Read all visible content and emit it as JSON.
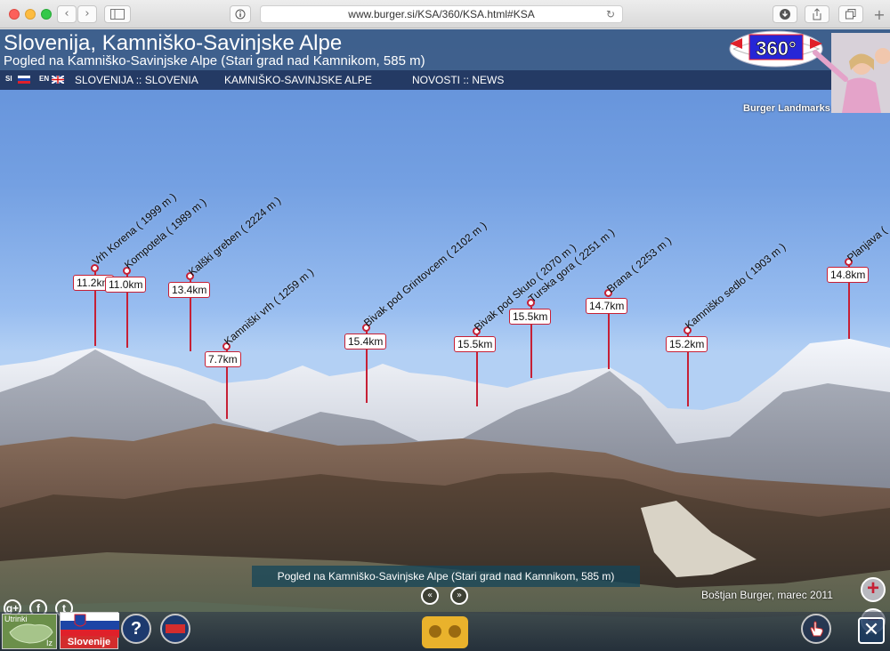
{
  "browser": {
    "url": "www.burger.si/KSA/360/KSA.html#KSA",
    "back": "‹",
    "forward": "›"
  },
  "header": {
    "title": "Slovenija, Kamniško-Savinjske Alpe",
    "subtitle": "Pogled na Kamniško-Savinjske Alpe (Stari grad nad Kamnikom, 585 m)",
    "logo_text": "360°",
    "brand": "Burger Landmarks"
  },
  "menu": {
    "lang_si": "SI",
    "lang_en": "EN",
    "items": [
      "SLOVENIJA :: SLOVENIA",
      "KAMNIŠKO-SAVINJSKE ALPE",
      "NOVOSTI :: NEWS"
    ]
  },
  "peaks": [
    {
      "name": "Vrh Korena ( 1999 m )",
      "dist": "11.2km"
    },
    {
      "name": "Kompotela ( 1989 m )",
      "dist": "11.0km"
    },
    {
      "name": "Kalški greben ( 2224 m )",
      "dist": "13.4km"
    },
    {
      "name": "Kamniški vrh ( 1259 m )",
      "dist": "7.7km"
    },
    {
      "name": "Bivak pod Grintovcem ( 2102 m )",
      "dist": "15.4km"
    },
    {
      "name": "Bivak pod Skuto ( 2070 m )",
      "dist": "15.5km"
    },
    {
      "name": "Turska gora ( 2251 m )",
      "dist": "15.5km"
    },
    {
      "name": "Brana ( 2253 m )",
      "dist": "14.7km"
    },
    {
      "name": "Kamniško sedlo ( 1903 m )",
      "dist": "15.2km"
    },
    {
      "name": "Planjava (",
      "dist": "14.8km"
    }
  ],
  "footer": {
    "caption": "Pogled na Kamniško-Savinjske Alpe (Stari grad nad Kamnikom, 585 m)",
    "credit": "Boštjan Burger, marec 2011",
    "map_label_top": "Utrinki",
    "map_label_bottom": "Iz",
    "country_label": "Slovenije",
    "help": "?",
    "close": "✕",
    "zoom_in": "+",
    "zoom_out": "−",
    "prev": "«",
    "next": "»"
  },
  "social": {
    "google": "g+",
    "facebook": "f",
    "twitter": "t"
  }
}
